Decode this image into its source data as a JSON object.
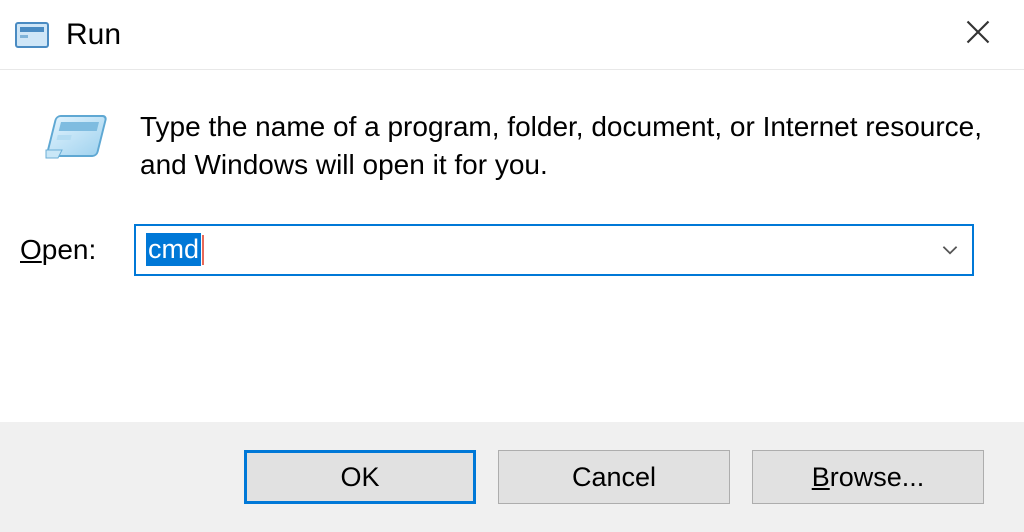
{
  "titlebar": {
    "title": "Run"
  },
  "content": {
    "description": "Type the name of a program, folder, document, or Internet resource, and Windows will open it for you.",
    "open_label_underlined": "O",
    "open_label_rest": "pen:",
    "input_value": "cmd"
  },
  "buttons": {
    "ok": "OK",
    "cancel": "Cancel",
    "browse_underlined": "B",
    "browse_rest": "rowse..."
  }
}
